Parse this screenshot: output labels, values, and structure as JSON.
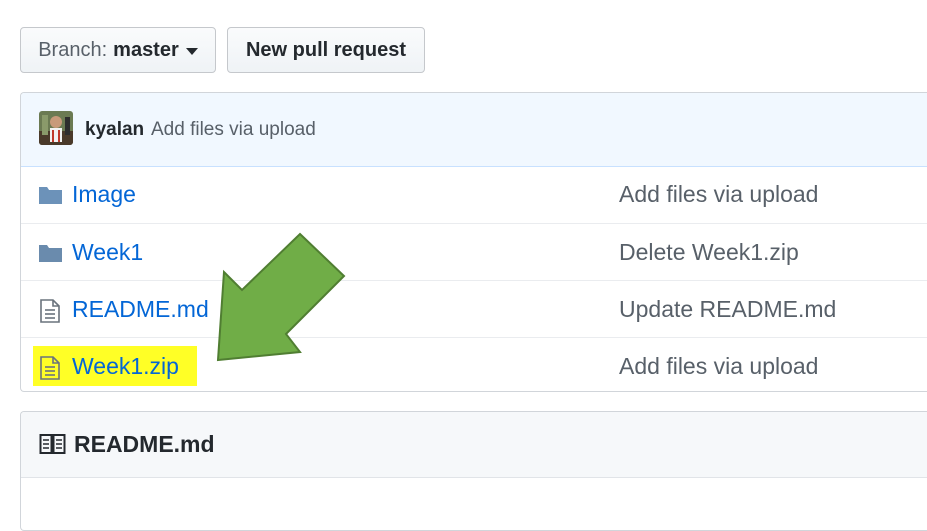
{
  "toolbar": {
    "branch_prefix": "Branch:",
    "branch_name": "master",
    "new_pr_label": "New pull request"
  },
  "latest_commit": {
    "author": "kyalan",
    "message": "Add files via upload"
  },
  "files": [
    {
      "name": "Image",
      "type": "folder",
      "message": "Add files via upload"
    },
    {
      "name": "Week1",
      "type": "folder",
      "message": "Delete Week1.zip"
    },
    {
      "name": "README.md",
      "type": "file",
      "message": "Update README.md"
    },
    {
      "name": "Week1.zip",
      "type": "file",
      "message": "Add files via upload",
      "highlighted": true
    }
  ],
  "readme": {
    "title": "README.md"
  },
  "colors": {
    "link": "#0366d6",
    "highlight": "#ffff00",
    "arrow_fill": "#70ad47",
    "arrow_stroke": "#507e32",
    "folder": "#79b8ff"
  },
  "icons": {
    "folder": "folder-icon",
    "file": "file-text-icon",
    "readme": "book-icon",
    "caret": "caret-down-icon"
  }
}
